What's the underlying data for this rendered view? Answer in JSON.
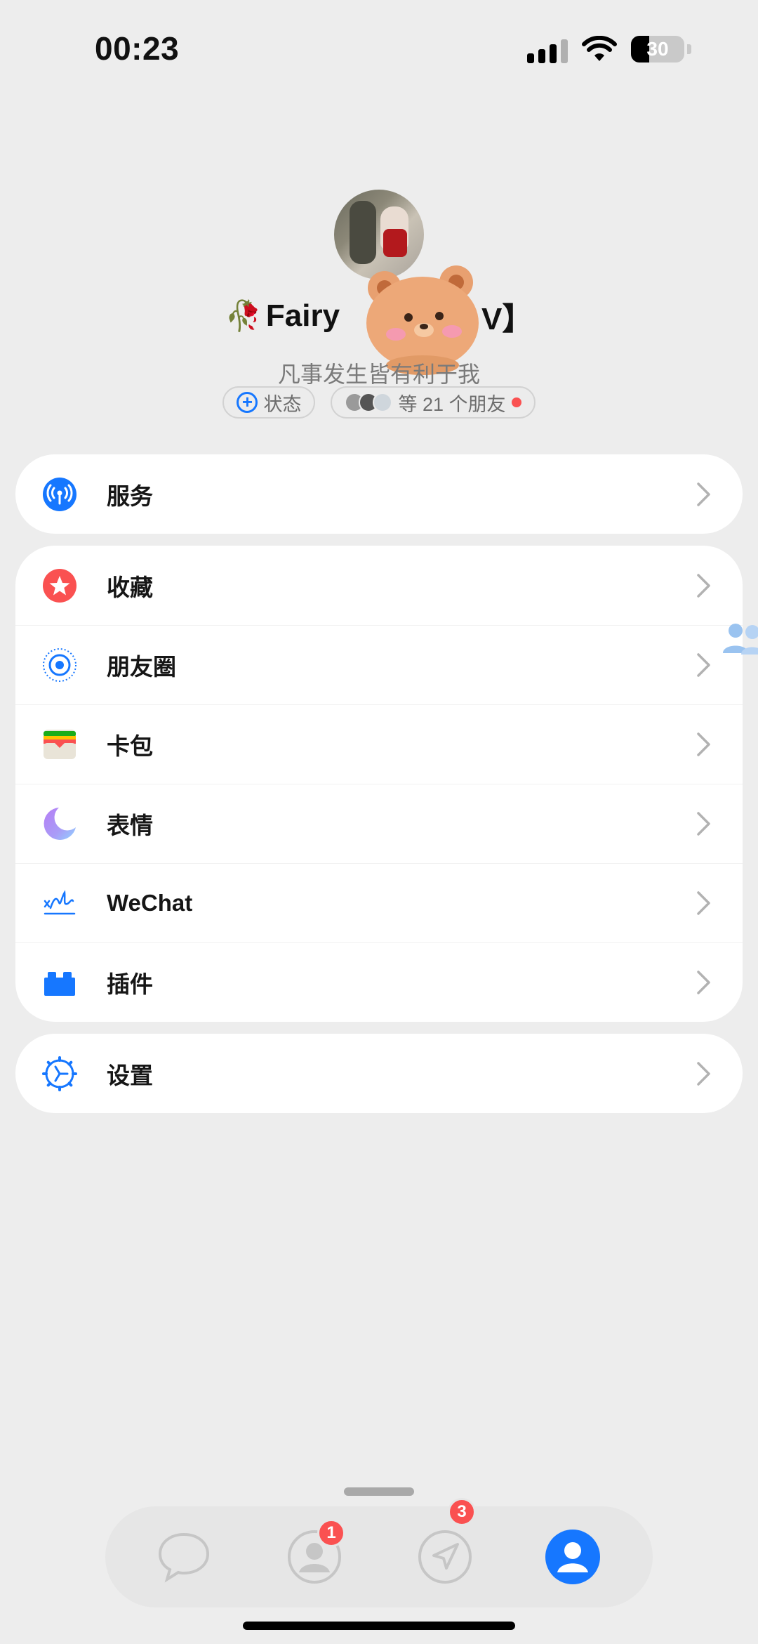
{
  "status_bar": {
    "time": "00:23",
    "battery": "30"
  },
  "profile": {
    "name_visible_prefix": "Fairy",
    "name_visible_suffix": "V】",
    "signature": "凡事发生皆有利于我",
    "status_chip": "状态",
    "friends_chip": "等 21 个朋友"
  },
  "menu": {
    "services": "服务",
    "favorites": "收藏",
    "moments": "朋友圈",
    "cards": "卡包",
    "stickers": "表情",
    "wechat": "WeChat",
    "plugins": "插件",
    "settings": "设置"
  },
  "tabbar": {
    "contacts_badge": "1",
    "discover_badge": "3"
  },
  "colors": {
    "accent": "#1677ff",
    "badge": "#fa5151",
    "background": "#ededed"
  }
}
